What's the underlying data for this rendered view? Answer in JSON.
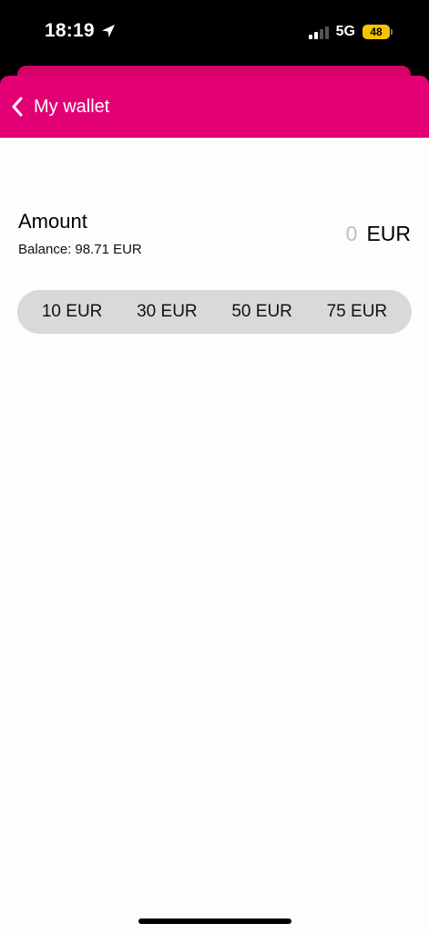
{
  "status_bar": {
    "time": "18:19",
    "network": "5G",
    "battery": "48",
    "location_icon": "location-arrow-icon",
    "signal_icon": "cellular-signal-icon"
  },
  "header": {
    "title": "My wallet",
    "back_icon": "chevron-left-icon",
    "color": "#e20074"
  },
  "amount": {
    "label": "Amount",
    "balance_label": "Balance:",
    "balance_value": "98.71 EUR",
    "value": "0",
    "currency": "EUR"
  },
  "presets": [
    {
      "label": "10 EUR"
    },
    {
      "label": "30 EUR"
    },
    {
      "label": "50 EUR"
    },
    {
      "label": "75 EUR"
    }
  ]
}
